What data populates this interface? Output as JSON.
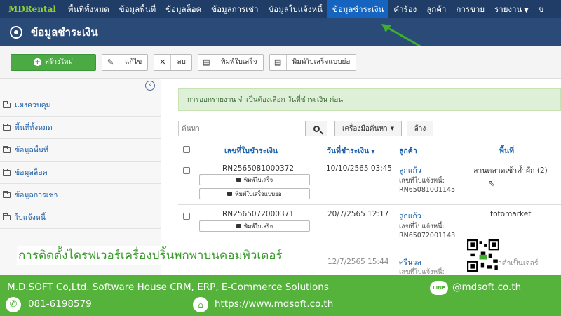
{
  "nav": {
    "brand": "MDRental",
    "items": [
      "พื้นที่ทั้งหมด",
      "ข้อมูลพื้นที่",
      "ข้อมูลล็อค",
      "ข้อมูลการเช่า",
      "ข้อมูลใบแจ้งหนี้",
      "ข้อมูลชำระเงิน",
      "คำร้อง",
      "ลูกค้า",
      "การขาย",
      "รายงาน",
      "ข"
    ],
    "active_index": 5
  },
  "page": {
    "title": "ข้อมูลชำระเงิน"
  },
  "toolbar": {
    "create_label": "สร้างใหม่",
    "edit_label": "แก้ไข",
    "delete_label": "ลบ",
    "print_receipt_label": "พิมพ์ใบเสร็จ",
    "print_receipt_short_label": "พิมพ์ใบเสร็จแบบย่อ"
  },
  "sidebar": {
    "items": [
      "แผงควบคุม",
      "พื้นที่ทั้งหมด",
      "ข้อมูลพื้นที่",
      "ข้อมูลล็อค",
      "ข้อมูลการเช่า",
      "ใบแจ้งหนี้"
    ]
  },
  "alert": {
    "text": "การออกรายงาน จำเป็นต้องเลือก วันที่ชำระเงิน ก่อน"
  },
  "search": {
    "placeholder": "ค้นหา",
    "tools_label": "เครื่องมือค้นหา",
    "clear_label": "ล้าง"
  },
  "table": {
    "headers": {
      "receipt": "เลขที่ใบชำระเงิน",
      "date": "วันที่ชำระเงิน",
      "customer": "ลูกค้า",
      "area": "พื้นที่"
    },
    "row_buttons": {
      "print": "พิมพ์ใบเสร็จ",
      "print_short": "พิมพ์ใบเสร็จแบบย่อ"
    },
    "rows": [
      {
        "receipt": "RN2565081000372",
        "date": "10/10/2565 03:45",
        "customer": "ลูกแก้ว",
        "invoice_label": "เลขที่ใบแจ้งหนี้:",
        "invoice": "RN65081001145",
        "area": "ลานตลาดเช้าค้ำผัก (2)"
      },
      {
        "receipt": "RN2565072000371",
        "date": "20/7/2565 12:17",
        "customer": "ลูกแก้ว",
        "invoice_label": "เลขที่ใบแจ้งหนี้:",
        "invoice": "RN65072001143",
        "area": "totomarket"
      },
      {
        "date": "12/7/2565 15:44",
        "customer": "ศรีนวล",
        "invoice_label": "เลขที่ใบแจ้งหนี้:",
        "invoice": "RN6507",
        "area": "ลูกค้าต่ำเป็นเจอร์"
      }
    ]
  },
  "overlay": {
    "title": "การติดตั้งไดรฟเวอร์เครื่องปริ้นพกพาบนคอมพิวเตอร์",
    "company": "M.D.SOFT Co,Ltd. Software House CRM, ERP, E-Commerce Solutions",
    "phone": "081-6198579",
    "website": "https://www.mdsoft.co.th",
    "line_label": "LINE",
    "line_id": "@mdsoft.co.th"
  },
  "colors": {
    "nav_bg": "#1f3d66",
    "active_tab": "#1565c0",
    "brand": "#8ccf3a",
    "banner": "#55b33c",
    "create_btn": "#4caa45"
  }
}
